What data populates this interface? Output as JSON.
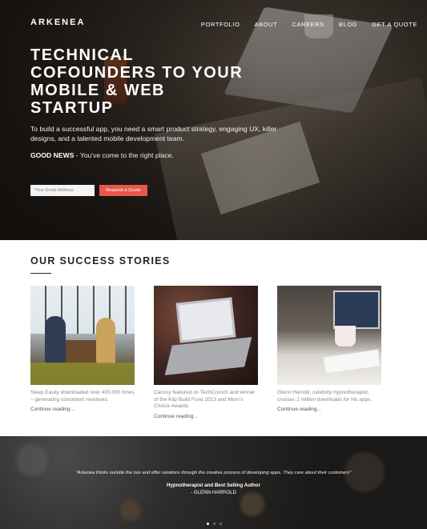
{
  "brand": {
    "logo": "ARKENEA"
  },
  "nav": {
    "items": [
      "PORTFOLIO",
      "ABOUT",
      "CAREERS",
      "BLOG",
      "GET A QUOTE"
    ]
  },
  "hero": {
    "title_lines": [
      "TECHNICAL",
      "COFOUNDERS TO YOUR",
      "MOBILE & WEB",
      "STARTUP"
    ],
    "subtitle": "To build a successful app, you need a smart product strategy, engaging UX, killer designs, and a talented mobile development team.",
    "good_news_label": "GOOD NEWS",
    "good_news_text": " - You've come to the right place.",
    "email_placeholder": "*Your Email Address",
    "cta_label": "Request a Quote"
  },
  "stories": {
    "heading": "OUR SUCCESS STORIES",
    "items": [
      {
        "description": "Sleep Easily downloaded over 400,000 times – generating consistent revenues.",
        "link": "Continue reading..."
      },
      {
        "description": "Canvsy featured on TechCrunch and winner of the Kiip Build Fund 2013 and Mom's Choice Awards",
        "link": "Continue reading..."
      },
      {
        "description": "Glenn Harrold, celebrity hypnotherapist, crosses 2 million downloads for his apps.",
        "link": "Continue reading..."
      }
    ]
  },
  "testimonial": {
    "quote": "\"Arkenea thinks outside the box and offer solutions through the creative process of developing apps. They care about their customers\"",
    "role": "Hypnotherapist and Best Selling Author",
    "name": "- GLENN HARROLD",
    "slides": 3,
    "active_slide": 1
  },
  "colors": {
    "accent": "#e8574b",
    "hero_text": "#ffffff",
    "heading": "#222222",
    "muted": "#888888"
  }
}
